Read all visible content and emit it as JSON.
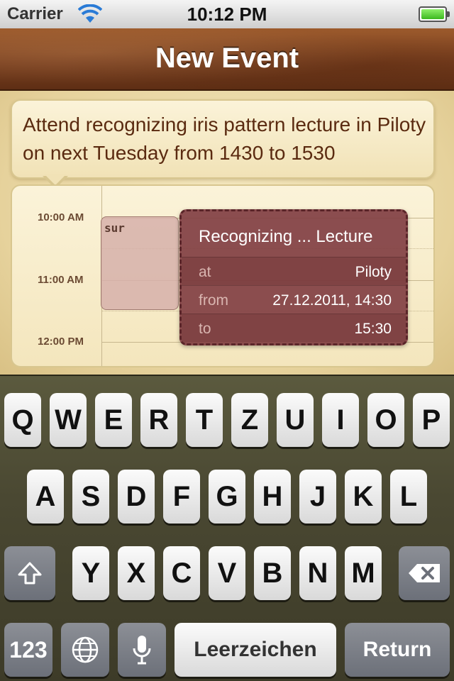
{
  "status_bar": {
    "carrier": "Carrier",
    "time": "10:12 PM"
  },
  "nav": {
    "title": "New Event"
  },
  "input_bubble": {
    "text": "Attend recognizing iris pattern lecture in Piloty on next Tuesday from 1430 to 1530"
  },
  "calendar": {
    "time_labels": [
      "10:00 AM",
      "11:00 AM",
      "12:00 PM"
    ],
    "existing_event_label": "sur",
    "event": {
      "title": "Recognizing ... Lecture",
      "at_label": "at",
      "at_value": "Piloty",
      "from_label": "from",
      "from_value": "27.12.2011, 14:30",
      "to_label": "to",
      "to_value": "15:30"
    }
  },
  "keyboard": {
    "row1": [
      "Q",
      "W",
      "E",
      "R",
      "T",
      "Z",
      "U",
      "I",
      "O",
      "P"
    ],
    "row2": [
      "A",
      "S",
      "D",
      "F",
      "G",
      "H",
      "J",
      "K",
      "L"
    ],
    "row3": [
      "Y",
      "X",
      "C",
      "V",
      "B",
      "N",
      "M"
    ],
    "numbers_label": "123",
    "space_label": "Leerzeichen",
    "return_label": "Return"
  }
}
